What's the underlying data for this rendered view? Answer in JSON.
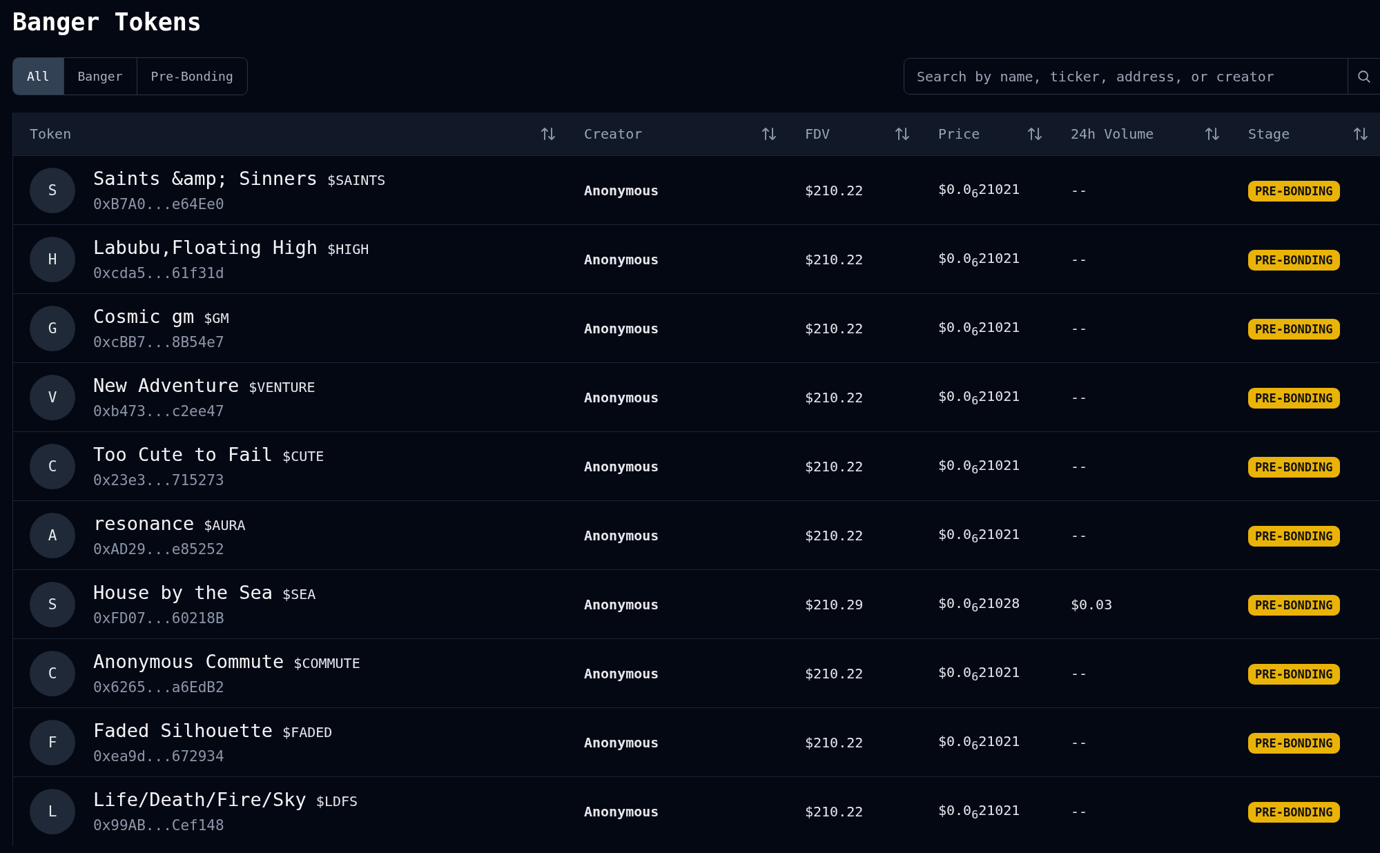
{
  "title": "Banger Tokens",
  "tabs": [
    {
      "label": "All",
      "selected": true
    },
    {
      "label": "Banger",
      "selected": false
    },
    {
      "label": "Pre-Bonding",
      "selected": false
    }
  ],
  "search": {
    "placeholder": "Search by name, ticker, address, or creator"
  },
  "table": {
    "columns": [
      "Token",
      "Creator",
      "FDV",
      "Price",
      "24h Volume",
      "Stage"
    ],
    "rows": [
      {
        "initial": "S",
        "name": "Saints &amp; Sinners",
        "ticker": "$SAINTS",
        "address": "0xB7A0...e64Ee0",
        "creator": "Anonymous",
        "fdv": "$210.22",
        "price": "$0.0$_{6}$21021",
        "volume": "--",
        "stage": "PRE-BONDING"
      },
      {
        "initial": "H",
        "name": "Labubu,Floating High",
        "ticker": "$HIGH",
        "address": "0xcda5...61f31d",
        "creator": "Anonymous",
        "fdv": "$210.22",
        "price": "$0.0$_{6}$21021",
        "volume": "--",
        "stage": "PRE-BONDING"
      },
      {
        "initial": "G",
        "name": "Cosmic gm",
        "ticker": "$GM",
        "address": "0xcBB7...8B54e7",
        "creator": "Anonymous",
        "fdv": "$210.22",
        "price": "$0.0$_{6}$21021",
        "volume": "--",
        "stage": "PRE-BONDING"
      },
      {
        "initial": "V",
        "name": "New Adventure",
        "ticker": "$VENTURE",
        "address": "0xb473...c2ee47",
        "creator": "Anonymous",
        "fdv": "$210.22",
        "price": "$0.0$_{6}$21021",
        "volume": "--",
        "stage": "PRE-BONDING"
      },
      {
        "initial": "C",
        "name": "Too Cute to Fail",
        "ticker": "$CUTE",
        "address": "0x23e3...715273",
        "creator": "Anonymous",
        "fdv": "$210.22",
        "price": "$0.0$_{6}$21021",
        "volume": "--",
        "stage": "PRE-BONDING"
      },
      {
        "initial": "A",
        "name": "resonance",
        "ticker": "$AURA",
        "address": "0xAD29...e85252",
        "creator": "Anonymous",
        "fdv": "$210.22",
        "price": "$0.0$_{6}$21021",
        "volume": "--",
        "stage": "PRE-BONDING"
      },
      {
        "initial": "S",
        "name": "House by the Sea",
        "ticker": "$SEA",
        "address": "0xFD07...60218B",
        "creator": "Anonymous",
        "fdv": "$210.29",
        "price": "$0.0$_{6}$21028",
        "volume": "$0.03",
        "stage": "PRE-BONDING"
      },
      {
        "initial": "C",
        "name": "Anonymous Commute",
        "ticker": "$COMMUTE",
        "address": "0x6265...a6EdB2",
        "creator": "Anonymous",
        "fdv": "$210.22",
        "price": "$0.0$_{6}$21021",
        "volume": "--",
        "stage": "PRE-BONDING"
      },
      {
        "initial": "F",
        "name": "Faded Silhouette",
        "ticker": "$FADED",
        "address": "0xea9d...672934",
        "creator": "Anonymous",
        "fdv": "$210.22",
        "price": "$0.0$_{6}$21021",
        "volume": "--",
        "stage": "PRE-BONDING"
      },
      {
        "initial": "L",
        "name": "Life/Death/Fire/Sky",
        "ticker": "$LDFS",
        "address": "0x99AB...Cef148",
        "creator": "Anonymous",
        "fdv": "$210.22",
        "price": "$0.0$_{6}$21021",
        "volume": "--",
        "stage": "PRE-BONDING"
      }
    ]
  }
}
